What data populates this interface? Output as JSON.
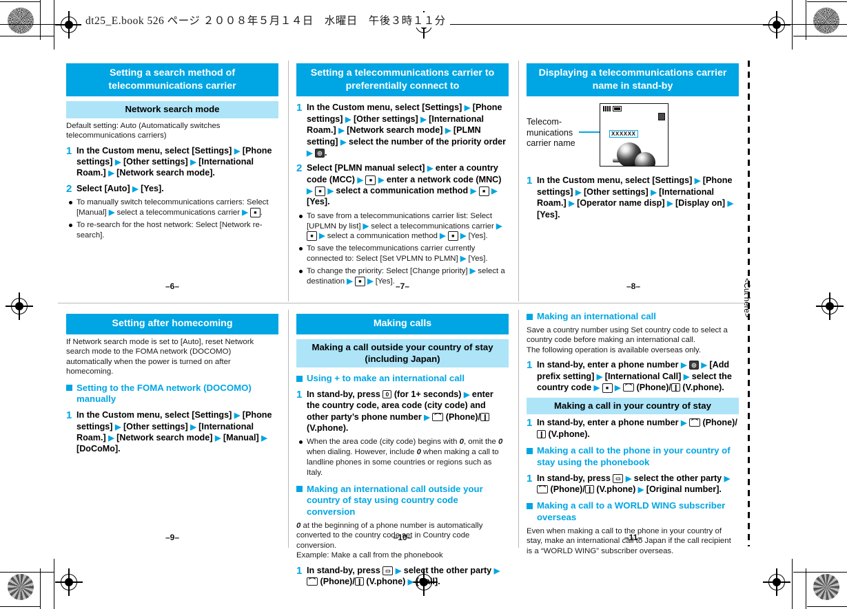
{
  "header": {
    "stamp": "dt25_E.book  526 ページ  ２００８年５月１４日　水曜日　午後３時１１分"
  },
  "margin": {
    "cut_label": "<Cut here>"
  },
  "colors": {
    "accent": "#00a5e3",
    "subheader": "#ade4f7",
    "text": "#1a1a1a"
  },
  "panels": [
    {
      "id": "search-method",
      "title": "Setting a search method of telecommunications carrier",
      "subtitle": "Network search mode",
      "note": "Default setting: Auto (Automatically switches telecommunications carriers)",
      "steps": [
        {
          "num": "1",
          "text_html": "In the Custom menu, select [Settings] <span class=\"arr\">&#9654;</span> [Phone settings] <span class=\"arr\">&#9654;</span> [Other settings] <span class=\"arr\">&#9654;</span> [International Roam.] <span class=\"arr\">&#9654;</span> [Network search mode]."
        },
        {
          "num": "2",
          "text_html": "Select [Auto] <span class=\"arr\">&#9654;</span> [Yes]."
        }
      ],
      "bullets": [
        "To manually switch telecommunications carriers: Select [Manual] <span class=\"arr\">&#9654;</span> select a telecommunications carrier <span class=\"arr\">&#9654;</span> <span class=\"key sq\"></span>.",
        "To re-search for the host network: Select [Network re-search]."
      ],
      "folio": "–6–"
    },
    {
      "id": "preferential-carrier",
      "title": "Setting a telecommunications carrier to preferentially connect to",
      "steps": [
        {
          "num": "1",
          "text_html": "In the Custom menu, select [Settings] <span class=\"arr\">&#9654;</span> [Phone settings] <span class=\"arr\">&#9654;</span> [Other settings] <span class=\"arr\">&#9654;</span> [International Roam.] <span class=\"arr\">&#9654;</span> [Network search mode] <span class=\"arr\">&#9654;</span> [PLMN setting] <span class=\"arr\">&#9654;</span> select the number of the priority order <span class=\"arr\">&#9654;</span> <span class=\"key cam\"></span>."
        },
        {
          "num": "2",
          "text_html": "Select [PLMN manual select] <span class=\"arr\">&#9654;</span> enter a country code (MCC) <span class=\"arr\">&#9654;</span> <span class=\"key sq\"></span> <span class=\"arr\">&#9654;</span> enter a network code (MNC) <span class=\"arr\">&#9654;</span> <span class=\"key sq\"></span> <span class=\"arr\">&#9654;</span> select a communication method <span class=\"arr\">&#9654;</span> <span class=\"key sq\"></span> <span class=\"arr\">&#9654;</span> [Yes]."
        }
      ],
      "bullets": [
        "To save from a telecommunications carrier list: Select [UPLMN by list] <span class=\"arr\">&#9654;</span> select a telecommunications carrier <span class=\"arr\">&#9654;</span> <span class=\"key sq\"></span> <span class=\"arr\">&#9654;</span> select a communication method <span class=\"arr\">&#9654;</span> <span class=\"key sq\"></span> <span class=\"arr\">&#9654;</span> [Yes].",
        "To save the telecommunications carrier currently connected to: Select [Set VPLMN to PLMN] <span class=\"arr\">&#9654;</span> [Yes].",
        "To change the priority: Select [Change priority] <span class=\"arr\">&#9654;</span> select a destination <span class=\"arr\">&#9654;</span> <span class=\"key sq\"></span> <span class=\"arr\">&#9654;</span> [Yes]."
      ],
      "folio": "–7–"
    },
    {
      "id": "carrier-name-standby",
      "title": "Displaying a telecommunications carrier name in stand-by",
      "illustration": {
        "label": "Telecom-munications carrier name",
        "label_lines": [
          "Telecom-",
          "munications",
          "carrier name"
        ],
        "screen_carrier_text": "XXXXXX"
      },
      "steps": [
        {
          "num": "1",
          "text_html": "In the Custom menu, select [Settings] <span class=\"arr\">&#9654;</span> [Phone settings] <span class=\"arr\">&#9654;</span> [Other settings] <span class=\"arr\">&#9654;</span> [International Roam.] <span class=\"arr\">&#9654;</span> [Operator name disp] <span class=\"arr\">&#9654;</span> [Display on] <span class=\"arr\">&#9654;</span> [Yes]."
        }
      ],
      "folio": "–8–"
    },
    {
      "id": "after-homecoming",
      "title": "Setting after homecoming",
      "note": "If Network search mode is set to [Auto], reset Network search mode to the FOMA network (DOCOMO) automatically when the power is turned on after homecoming.",
      "h3": "Setting to the FOMA network (DOCOMO) manually",
      "steps": [
        {
          "num": "1",
          "text_html": "In the Custom menu, select [Settings] <span class=\"arr\">&#9654;</span> [Phone settings] <span class=\"arr\">&#9654;</span> [Other settings] <span class=\"arr\">&#9654;</span> [International Roam.] <span class=\"arr\">&#9654;</span> [Network search mode] <span class=\"arr\">&#9654;</span> [Manual] <span class=\"arr\">&#9654;</span> [DoCoMo]."
        }
      ],
      "folio": "–9–"
    },
    {
      "id": "making-calls",
      "title": "Making calls",
      "subtitle": "Making a call outside your country of stay (including Japan)",
      "section1": {
        "h3": "Using + to make an international call",
        "steps": [
          {
            "num": "1",
            "text_html": "In stand-by, press <span class=\"key\">0</span> (for 1+ seconds) <span class=\"arr\">&#9654;</span> enter the country code, area code (city code) and other party&#8217;s phone number <span class=\"arr\">&#9654;</span> <span class=\"key phone\"></span> (Phone)/<span class=\"key vphone\"></span> (V.phone)."
          }
        ],
        "bullets": [
          "When the area code (city code) begins with <i>0</i>, omit the <i>0</i> when dialing. However, include <i>0</i> when making a call to landline phones in some countries or regions such as Italy."
        ]
      },
      "section2": {
        "h3": "Making an international call outside your country of stay using country code conversion",
        "note_html": "<i>0</i> at the beginning of a phone number is automatically converted to the country code set in Country code conversion.<br>Example: Make a call from the phonebook",
        "steps": [
          {
            "num": "1",
            "text_html": "In stand-by, press <span class=\"key book\"></span> <span class=\"arr\">&#9654;</span> select the other party <span class=\"arr\">&#9654;</span> <span class=\"key phone\"></span> (Phone)/<span class=\"key vphone\"></span> (V.phone) <span class=\"arr\">&#9654;</span> [Call]."
          }
        ]
      },
      "folio": "–10–"
    },
    {
      "id": "international-call",
      "section1": {
        "h3": "Making an international call",
        "note": "Save a country number using Set country code to select a country code before making an international call.\nThe following operation is available overseas only.",
        "steps": [
          {
            "num": "1",
            "text_html": "In stand-by, enter a phone number <span class=\"arr\">&#9654;</span> <span class=\"key cam\"></span> <span class=\"arr\">&#9654;</span> [Add prefix setting] <span class=\"arr\">&#9654;</span> [International Call] <span class=\"arr\">&#9654;</span> select the country code <span class=\"arr\">&#9654;</span> <span class=\"key sq\"></span> <span class=\"arr\">&#9654;</span> <span class=\"key phone\"></span> (Phone)/<span class=\"key vphone\"></span> (V.phone)."
          }
        ]
      },
      "subtitle": "Making a call in your country of stay",
      "section2": {
        "steps": [
          {
            "num": "1",
            "text_html": "In stand-by, enter a phone number <span class=\"arr\">&#9654;</span> <span class=\"key phone\"></span> (Phone)/<span class=\"key vphone\"></span> (V.phone)."
          }
        ]
      },
      "section3": {
        "h3": "Making a call to the phone in your country of stay using the phonebook",
        "steps": [
          {
            "num": "1",
            "text_html": "In stand-by, press <span class=\"key book\"></span> <span class=\"arr\">&#9654;</span> select the other party <span class=\"arr\">&#9654;</span> <span class=\"key phone\"></span> (Phone)/<span class=\"key vphone\"></span> (V.phone) <span class=\"arr\">&#9654;</span> [Original number]."
          }
        ]
      },
      "section4": {
        "h3": "Making a call to a WORLD WING subscriber overseas",
        "note": "Even when making a call to the phone in your country of stay, make an international call to Japan if the call recipient is a “WORLD WING” subscriber overseas."
      },
      "folio": "–11–"
    }
  ]
}
